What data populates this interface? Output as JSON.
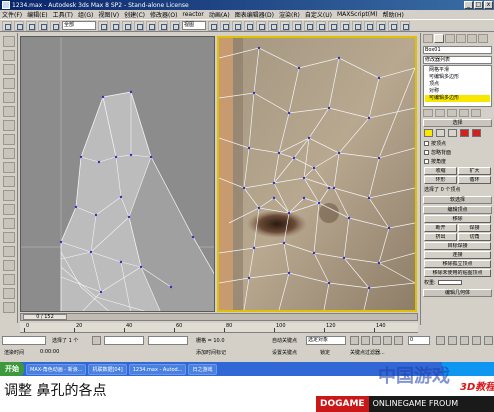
{
  "window": {
    "title": "1234.max - Autodesk 3ds Max 8 SP2 - Stand-alone License",
    "controls": [
      "_",
      "□",
      "x"
    ]
  },
  "menubar": {
    "items": [
      "文件(F)",
      "编辑(E)",
      "工具(T)",
      "组(G)",
      "视图(V)",
      "创建(C)",
      "修改器(O)",
      "reactor",
      "动画(A)",
      "图表编辑器(D)",
      "渲染(R)",
      "自定义(U)",
      "MAXScript(M)",
      "帮助(H)"
    ]
  },
  "toolbar": {
    "selection_filter": "全部",
    "reference_coord": "视图"
  },
  "viewports": {
    "left_label": "",
    "right_label": ""
  },
  "command_panel": {
    "object_name": "Box01",
    "modifier_list": "修改器列表",
    "stack": [
      {
        "label": "网格平滑",
        "selected": false
      },
      {
        "label": "可编辑多边形",
        "selected": false
      },
      {
        "label": "顶点",
        "selected": false
      },
      {
        "label": "对称",
        "selected": false
      },
      {
        "label": "可编辑多边形",
        "selected": true
      }
    ],
    "selection_rollout": "选择",
    "by_vertex": "按顶点",
    "ignore_backfacing": "忽略背面",
    "by_angle": "按角度",
    "shrink": "收缩",
    "grow": "扩大",
    "ring": "环形",
    "loop": "循环",
    "selected_status": "选择了 0 个顶点",
    "soft_selection_rollout": "软选择",
    "edit_vertices_rollout": "编辑顶点",
    "remove": "移除",
    "break": "断开",
    "extrude": "挤出",
    "weld": "焊接",
    "chamfer": "切角",
    "target_weld": "目标焊接",
    "connect": "连接",
    "remove_isolated": "移除孤立顶点",
    "remove_unused_map": "移除未使用的贴图顶点",
    "weight_label": "权重:",
    "edit_geometry_rollout": "编辑几何体"
  },
  "timeline": {
    "frame_display": "0 / 152",
    "ruler_ticks": [
      "0",
      "20",
      "40",
      "60",
      "80",
      "100",
      "120",
      "140"
    ]
  },
  "statusbar": {
    "selected_count": "选择了 1 个",
    "grid": "栅格 = 10.0",
    "auto_key": "自动关键点",
    "selected_dropdown": "选定对象",
    "set_key": "设置关键点",
    "key_filters": "关键点过滤器...",
    "add_time_tag": "添加时间标记",
    "frame_field": "0",
    "lock_label": "锁定",
    "time_label": "渲染时间",
    "time_value": "0:00:00"
  },
  "taskbar": {
    "start": "开始",
    "tasks": [
      "MAX-角色动画 - 新浪...",
      "机联数据[04]",
      "1234.max - Autod...",
      "日之游戏"
    ]
  },
  "caption": "调整 鼻孔的各点",
  "watermark": {
    "top_text": "中国游戏",
    "badge": "3D教程",
    "brand": "DOGAME",
    "url": "ONLINEGAME FROUM"
  }
}
